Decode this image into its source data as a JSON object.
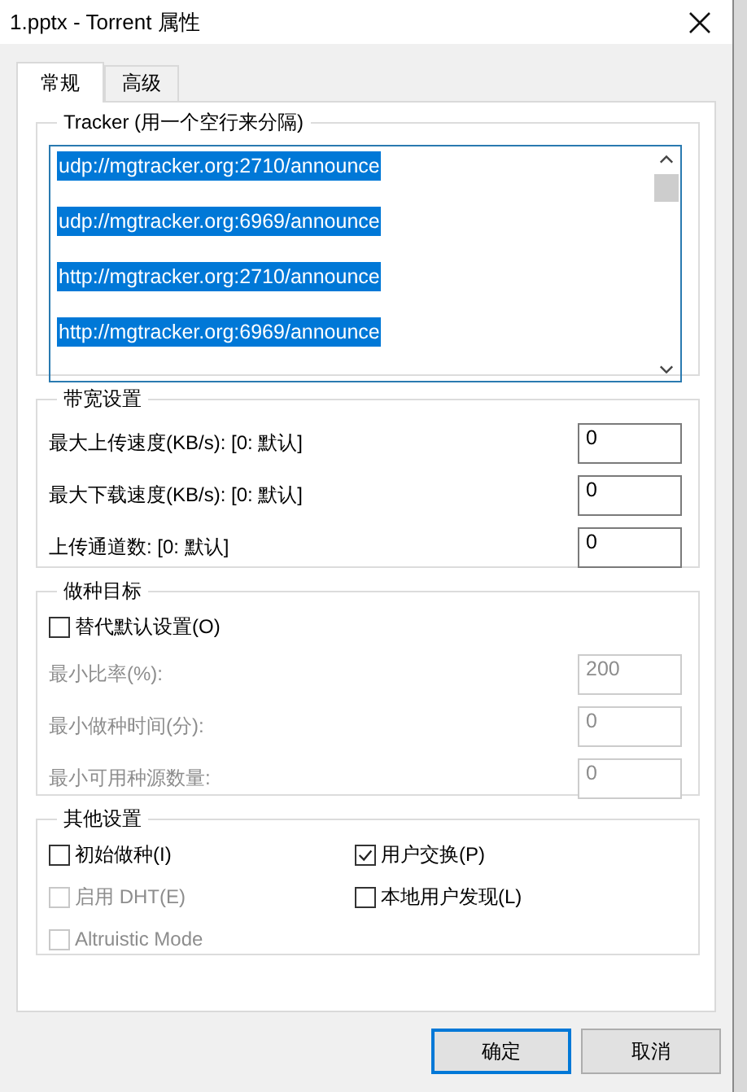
{
  "window": {
    "title": "1.pptx - Torrent 属性"
  },
  "tabs": [
    {
      "label": "常规",
      "selected": true
    },
    {
      "label": "高级",
      "selected": false
    }
  ],
  "tracker": {
    "title": "Tracker (用一个空行来分隔)",
    "items": [
      {
        "text": "udp://mgtracker.org:2710/announce",
        "selected": true
      },
      {
        "text": "udp://mgtracker.org:6969/announce",
        "selected": true
      },
      {
        "text": "http://mgtracker.org:2710/announce",
        "selected": true
      },
      {
        "text": "http://mgtracker.org:6969/announce",
        "selected": true
      }
    ]
  },
  "bandwidth": {
    "title": "带宽设置",
    "fields": [
      {
        "label": "最大上传速度(KB/s): [0: 默认]",
        "value": "0",
        "disabled": false
      },
      {
        "label": "最大下载速度(KB/s): [0: 默认]",
        "value": "0",
        "disabled": false
      },
      {
        "label": "上传通道数: [0: 默认]",
        "value": "0",
        "disabled": false
      }
    ]
  },
  "seeding": {
    "title": "做种目标",
    "override": {
      "label": "替代默认设置(O)",
      "checked": false
    },
    "fields": [
      {
        "label": "最小比率(%):",
        "value": "200",
        "disabled": true
      },
      {
        "label": "最小做种时间(分):",
        "value": "0",
        "disabled": true
      },
      {
        "label": "最小可用种源数量:",
        "value": "0",
        "disabled": true
      }
    ]
  },
  "other": {
    "title": "其他设置",
    "options": [
      {
        "label": "初始做种(I)",
        "checked": false,
        "disabled": false
      },
      {
        "label": "用户交换(P)",
        "checked": true,
        "disabled": false
      },
      {
        "label": "启用 DHT(E)",
        "checked": false,
        "disabled": true
      },
      {
        "label": "本地用户发现(L)",
        "checked": false,
        "disabled": false
      },
      {
        "label": "Altruistic Mode",
        "checked": false,
        "disabled": true
      }
    ]
  },
  "buttons": [
    {
      "label": "确定",
      "default": true
    },
    {
      "label": "取消",
      "default": false
    }
  ]
}
